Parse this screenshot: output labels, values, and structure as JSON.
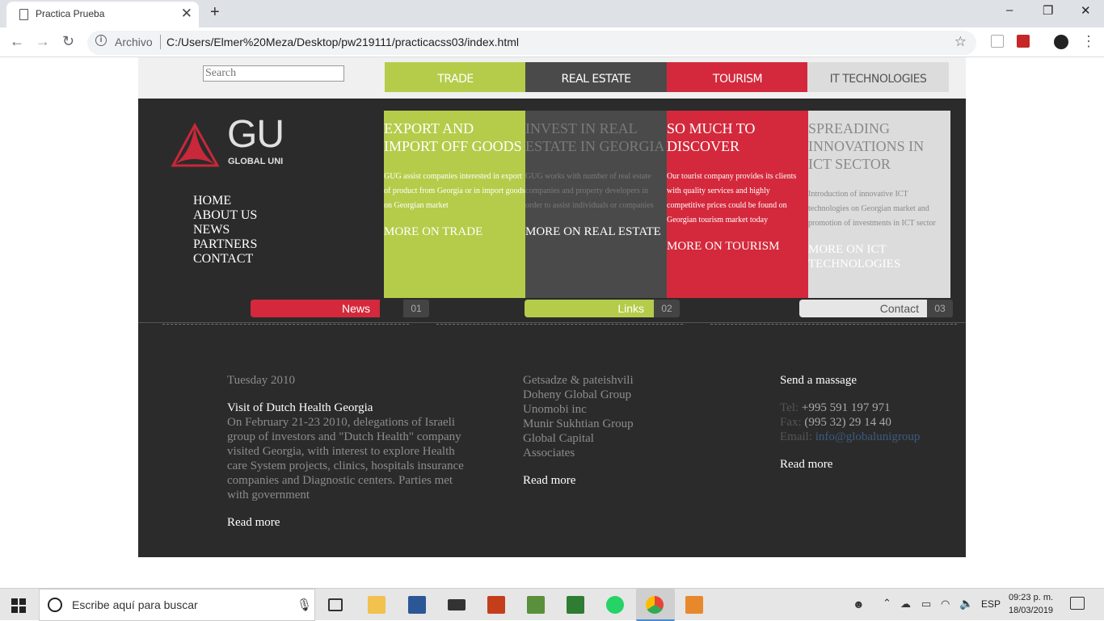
{
  "browser": {
    "tab_title": "Practica Prueba",
    "tab_close": "✕",
    "new_tab": "+",
    "scheme_label": "Archivo",
    "url": "C:/Users/Elmer%20Meza/Desktop/pw219111/practicacss03/index.html",
    "window_controls": [
      "–",
      "❐",
      "✕"
    ]
  },
  "page": {
    "search_placeholder": "Search",
    "top_tabs": [
      {
        "label": "TRADE",
        "bg": "#b4cc4a",
        "fg": "#ffffff"
      },
      {
        "label": "REAL ESTATE",
        "bg": "#4a4a4a",
        "fg": "#ffffff"
      },
      {
        "label": "TOURISM",
        "bg": "#d4293c",
        "fg": "#ffffff"
      },
      {
        "label": "IT TECHNOLOGIES",
        "bg": "#dcdcdc",
        "fg": "#555555"
      }
    ],
    "logo": {
      "mark": "GU",
      "sub": "GLOBAL UNI"
    },
    "nav": [
      "HOME",
      "ABOUT US",
      "NEWS",
      "PARTNERS",
      "CONTACT"
    ],
    "panels": [
      {
        "heading": "EXPORT AND IMPORT OFF GOODS",
        "body": "GUG assist companies interested in export of product from Georgia or in import goods on Georgian market",
        "link": "MORE ON TRADE",
        "bg": "#b4cc4a",
        "fg": "#ffffff",
        "bodyfg": "#ffffff",
        "linkfg": "#ffffff"
      },
      {
        "heading": "INVEST IN REAL ESTATE IN GEORGIA",
        "body": "GUG works with number of real estate companies and property developers in order to assist individuals or companies",
        "link": "MORE ON REAL ESTATE",
        "bg": "#4a4a4a",
        "fg": "#7a7a7a",
        "bodyfg": "#7a7a7a",
        "linkfg": "#ffffff"
      },
      {
        "heading": "SO MUCH TO DISCOVER",
        "body": "Our tourist company provides its clients with quality services and highly competitive prices could be found on Georgian tourism market today",
        "link": "MORE ON TOURISM",
        "bg": "#d4293c",
        "fg": "#ffffff",
        "bodyfg": "#ffffff",
        "linkfg": "#ffffff"
      },
      {
        "heading": "SPREADING INNOVATIONS IN ICT SECTOR",
        "body": "Introduction of innovative ICT technologies on Georgian market and promotion of investments in ICT sector",
        "link": "MORE ON ICT TECHNOLOGIES",
        "bg": "#dcdcdc",
        "fg": "#8a8a8a",
        "bodyfg": "#8a8a8a",
        "linkfg": "#ffffff"
      }
    ],
    "sections": [
      {
        "label": "News",
        "num": "01",
        "bar": "#d4293c",
        "fg": "#ffffff"
      },
      {
        "label": "Links",
        "num": "02",
        "bar": "#b4cc4a",
        "fg": "#ffffff"
      },
      {
        "label": "Contact",
        "num": "03",
        "bar": "#e6e6e6",
        "fg": "#555555"
      }
    ],
    "news": {
      "date": "Tuesday 2010",
      "title": "Visit of Dutch Health Georgia",
      "body": "On February 21-23 2010, delegations of Israeli group of investors and \"Dutch Health\" company visited Georgia, with interest to explore Health care System projects, clinics, hospitals insurance companies and Diagnostic centers. Parties met with government",
      "read_more": "Read more"
    },
    "links": {
      "items": [
        "Getsadze & pateishvili",
        "Doheny Global Group",
        "Unomobi inc",
        "Munir Sukhtian Group",
        "Global Capital",
        "Associates"
      ],
      "read_more": "Read more"
    },
    "contact": {
      "title": "Send a massage",
      "tel_label": "Tel:",
      "tel": "+995 591 197 971",
      "fax_label": "Fax:",
      "fax": "(995 32) 29 14 40",
      "email_label": "Email:",
      "email": "info@globalunigroup",
      "read_more": "Read more"
    }
  },
  "taskbar": {
    "search_placeholder": "Escribe aquí para buscar",
    "lang": "ESP",
    "time": "09:23 p. m.",
    "date": "18/03/2019"
  }
}
